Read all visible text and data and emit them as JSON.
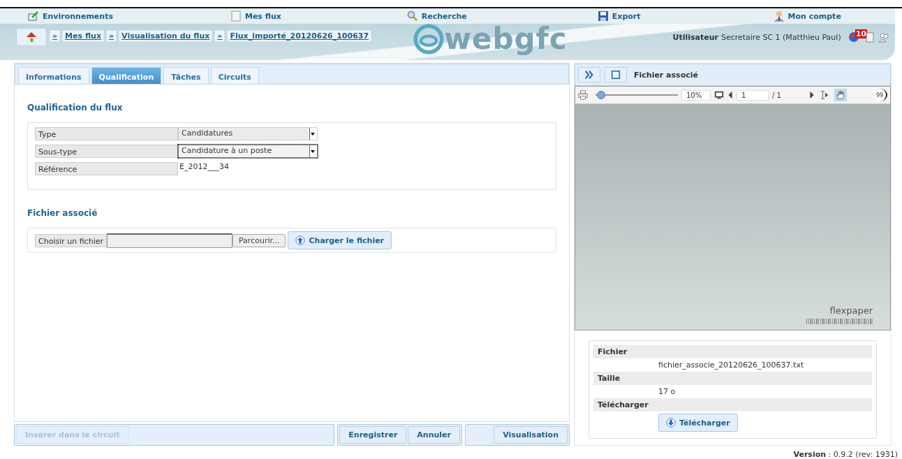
{
  "nav": [
    {
      "label": "Environnements"
    },
    {
      "label": "Mes flux"
    },
    {
      "label": "Recherche"
    },
    {
      "label": "Export"
    },
    {
      "label": "Mon compte"
    }
  ],
  "breadcrumb": [
    "Mes flux",
    "Visualisation du flux",
    "Flux_importé_20120626_100637"
  ],
  "breadcrumb_separator": "»",
  "logo": "webgfc",
  "user": {
    "label": "Utilisateur",
    "name": "Secretaire SC 1 (Matthieu Paul)",
    "badge": "10"
  },
  "tabs": [
    {
      "label": "Informations",
      "selected": false
    },
    {
      "label": "Qualification",
      "selected": true
    },
    {
      "label": "Tâches",
      "selected": false
    },
    {
      "label": "Circuits",
      "selected": false
    }
  ],
  "qualification": {
    "title": "Qualification du flux",
    "fields": [
      {
        "label": "Type",
        "kind": "select",
        "value": "Candidatures",
        "focused": false
      },
      {
        "label": "Sous-type",
        "kind": "select",
        "value": "Candidature à un poste",
        "focused": true
      },
      {
        "label": "Référence",
        "kind": "text",
        "value": "E_2012___34"
      }
    ]
  },
  "upload": {
    "title": "Fichier associé",
    "label": "Choisir un fichier",
    "browse": "Parcourir...",
    "submit": "Charger le fichier"
  },
  "action_groups": [
    [
      {
        "label": "Insérer dans le circuit",
        "disabled": true
      }
    ],
    [
      {
        "label": "Enregistrer",
        "disabled": false
      },
      {
        "label": "Annuler",
        "disabled": false
      }
    ],
    [
      {
        "label": "Visualisation",
        "disabled": false
      }
    ]
  ],
  "viewer": {
    "title": "Fichier associé",
    "zoom": {
      "level": 0.02,
      "value": "10%"
    },
    "page": "1",
    "pages": "/ 1",
    "tools": [
      {
        "kind": "select",
        "selected": false
      },
      {
        "kind": "hand",
        "selected": true
      }
    ],
    "badge": "99",
    "brand": "flexpaper"
  },
  "file_info": [
    {
      "label": "Fichier",
      "value": "fichier_associe_20120626_100637.txt",
      "kind": "text"
    },
    {
      "label": "Taille",
      "value": "17 o",
      "kind": "text"
    },
    {
      "label": "Télécharger",
      "value": "Télécharger",
      "kind": "button"
    }
  ],
  "version": {
    "label": "Version",
    "value": ": 0.9.2 (rev: 1931)"
  }
}
